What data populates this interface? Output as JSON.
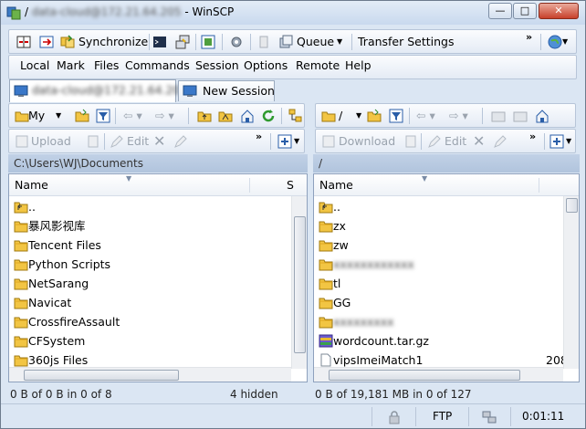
{
  "window": {
    "title_prefix": "/",
    "title_blurred": "data-cloud@172.21.64.205",
    "title_suffix": " - WinSCP",
    "buttons": {
      "minimize": "—",
      "maximize": "□",
      "close": "✕"
    }
  },
  "toolbar": {
    "synchronize": "Synchronize",
    "queue": "Queue",
    "transfer_settings": "Transfer Settings",
    "more": "»"
  },
  "menu": [
    "Local",
    "Mark",
    "Files",
    "Commands",
    "Session",
    "Options",
    "Remote",
    "Help"
  ],
  "tabs": [
    {
      "label_blurred": "data-cloud@172.21.64.205"
    },
    {
      "label": "New Session"
    }
  ],
  "left_panel": {
    "drive_label": "My",
    "upload": "Upload",
    "edit": "Edit",
    "path": "C:\\Users\\WJ\\Documents",
    "col_name": "Name",
    "col_size": "S",
    "files": [
      {
        "name": "..",
        "icon": "folder-up-icon"
      },
      {
        "name": "暴风影视库",
        "icon": "folder-icon"
      },
      {
        "name": "Tencent Files",
        "icon": "folder-icon"
      },
      {
        "name": "Python Scripts",
        "icon": "folder-icon"
      },
      {
        "name": "NetSarang",
        "icon": "folder-icon"
      },
      {
        "name": "Navicat",
        "icon": "folder-icon"
      },
      {
        "name": "CrossfireAssault",
        "icon": "folder-icon"
      },
      {
        "name": "CFSystem",
        "icon": "folder-icon"
      },
      {
        "name": "360js Files",
        "icon": "folder-icon"
      }
    ],
    "status": "0 B of 0 B in 0 of 8",
    "hidden": "4 hidden"
  },
  "right_panel": {
    "drive_label": "/",
    "download": "Download",
    "edit": "Edit",
    "path": "/",
    "col_name": "Name",
    "files": [
      {
        "name": "..",
        "icon": "folder-up-icon",
        "blurred": false,
        "size": ""
      },
      {
        "name": "zx",
        "icon": "folder-icon",
        "blurred": false,
        "size": ""
      },
      {
        "name": "zw",
        "icon": "folder-icon",
        "blurred": false,
        "size": ""
      },
      {
        "name": "xxxxxxxxxxxx",
        "icon": "folder-icon",
        "blurred": true,
        "size": ""
      },
      {
        "name": "tl",
        "icon": "folder-icon",
        "blurred": false,
        "size": ""
      },
      {
        "name": "GG",
        "icon": "folder-icon",
        "blurred": false,
        "size": ""
      },
      {
        "name": "xxxxxxxxx",
        "icon": "folder-icon",
        "blurred": true,
        "size": ""
      },
      {
        "name": "wordcount.tar.gz",
        "icon": "archive-icon",
        "blurred": false,
        "size": ""
      },
      {
        "name": "vipsImeiMatch1",
        "icon": "file-icon",
        "blurred": false,
        "size": "208"
      }
    ],
    "status": "0 B of 19,181 MB in 0 of 127"
  },
  "bottom": {
    "protocol": "FTP",
    "elapsed": "0:01:11"
  },
  "colors": {
    "folder": "#f2c543",
    "chrome": "#dbe6f3",
    "path_bar": "#b8cae1"
  }
}
